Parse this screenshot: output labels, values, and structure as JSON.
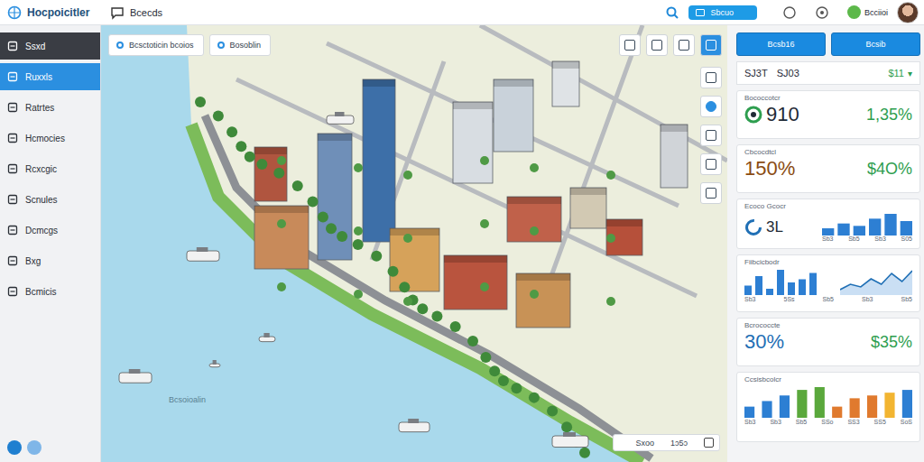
{
  "app": {
    "logo_text": "Hocpoicitler",
    "section": "Bcecds"
  },
  "topbar": {
    "button": "Sbcuo",
    "user": "Bcciioi"
  },
  "sidebar": {
    "items": [
      {
        "label": "Ssxd",
        "kind": "header",
        "selected": false
      },
      {
        "label": "Ruxxls",
        "kind": "item",
        "selected": true
      },
      {
        "label": "Ratrtes",
        "kind": "item",
        "selected": false
      },
      {
        "label": "Hcmocies",
        "kind": "item",
        "selected": false
      },
      {
        "label": "Rcxcgic",
        "kind": "item",
        "selected": false
      },
      {
        "label": "Scnules",
        "kind": "item",
        "selected": false
      },
      {
        "label": "Dcmcgs",
        "kind": "item",
        "selected": false
      },
      {
        "label": "Bxg",
        "kind": "item",
        "selected": false
      },
      {
        "label": "Bcmicis",
        "kind": "item",
        "selected": false
      }
    ]
  },
  "map": {
    "search_fields": [
      "Bcsctoticin bcoios",
      "Bosoblin"
    ],
    "water_label": "Bcsoioalin",
    "legend": {
      "label": "Sxoo",
      "value": "1ɔ5ɔ"
    }
  },
  "panel": {
    "buttons": [
      "Bcsb16",
      "Bcsib"
    ],
    "summary": [
      "SJ3T",
      "SJ03",
      "$11"
    ],
    "summary_caret": "▾",
    "cards": [
      {
        "kind": "stat-ring",
        "label": "Bococcotcr",
        "value": "910",
        "change": "1,35%",
        "color": "#1f2a36"
      },
      {
        "kind": "stat",
        "label": "Cbcocdtcl",
        "value": "150%",
        "change": "$4O%",
        "color": "#8a4b12"
      },
      {
        "kind": "ring-bars",
        "label": "Ecoco Gcocr",
        "value": "3L",
        "values": [
          3,
          5,
          4,
          7,
          9,
          6
        ],
        "ticks": [
          "Sb3",
          "Sb5",
          "Sb3",
          "S05"
        ]
      },
      {
        "kind": "bars-line",
        "label": "Fiibcicbodr",
        "values": [
          3,
          6,
          2,
          8,
          4,
          5,
          7
        ],
        "line": [
          2,
          4,
          3,
          6,
          4,
          8,
          5,
          9
        ],
        "ticks": [
          "Sb3",
          "5Ss",
          "Sb5",
          "Sb3",
          "Sb5"
        ]
      },
      {
        "kind": "stat",
        "label": "Bcrococcte",
        "value": "30%",
        "change": "$35%",
        "color": "#1f6fb5"
      },
      {
        "kind": "colored-bars",
        "label": "Ccsisbcolcr",
        "ticks": [
          "Sb3",
          "Sb3",
          "Sb5",
          "SSo",
          "SS3",
          "SS5",
          "SoS"
        ],
        "bars": [
          {
            "value": 4,
            "color": "#2d7fd3"
          },
          {
            "value": 6,
            "color": "#2d7fd3"
          },
          {
            "value": 8,
            "color": "#2d7fd3"
          },
          {
            "value": 10,
            "color": "#5aa83c"
          },
          {
            "value": 11,
            "color": "#5aa83c"
          },
          {
            "value": 4,
            "color": "#e07a2e"
          },
          {
            "value": 7,
            "color": "#e07a2e"
          },
          {
            "value": 8,
            "color": "#e07a2e"
          },
          {
            "value": 9,
            "color": "#f2b531"
          },
          {
            "value": 10,
            "color": "#2d7fd3"
          }
        ]
      }
    ]
  }
}
